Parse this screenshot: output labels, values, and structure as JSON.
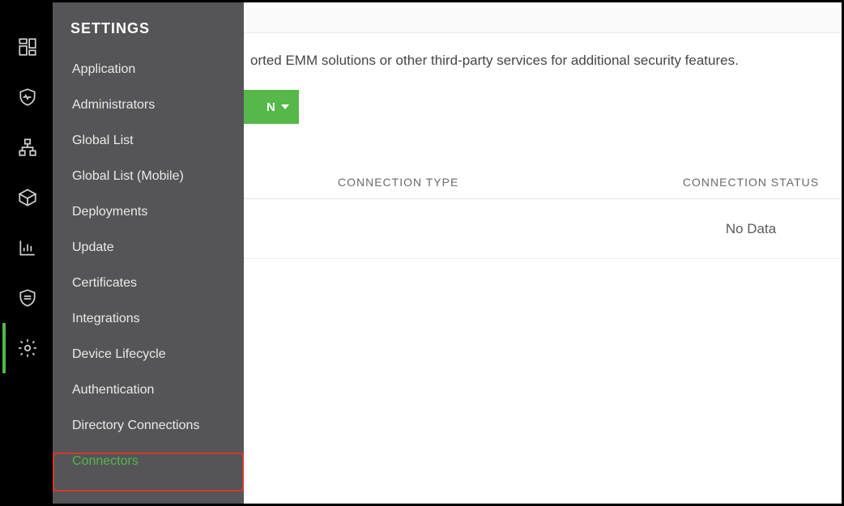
{
  "settings_panel": {
    "title": "SETTINGS",
    "items": [
      {
        "label": "Application"
      },
      {
        "label": "Administrators"
      },
      {
        "label": "Global List"
      },
      {
        "label": "Global List (Mobile)"
      },
      {
        "label": "Deployments"
      },
      {
        "label": "Update"
      },
      {
        "label": "Certificates"
      },
      {
        "label": "Integrations"
      },
      {
        "label": "Device Lifecycle"
      },
      {
        "label": "Authentication"
      },
      {
        "label": "Directory Connections"
      },
      {
        "label": "Connectors"
      }
    ],
    "active_index": 11
  },
  "content": {
    "description": "orted EMM solutions or other third-party services for additional security features.",
    "add_button_label": "N",
    "table": {
      "headers": {
        "type": "CONNECTION TYPE",
        "status": "CONNECTION STATUS"
      },
      "no_data": "No Data"
    }
  },
  "colors": {
    "accent": "#52b74b",
    "panel_bg": "#555557",
    "highlight_border": "#d03a2b"
  }
}
